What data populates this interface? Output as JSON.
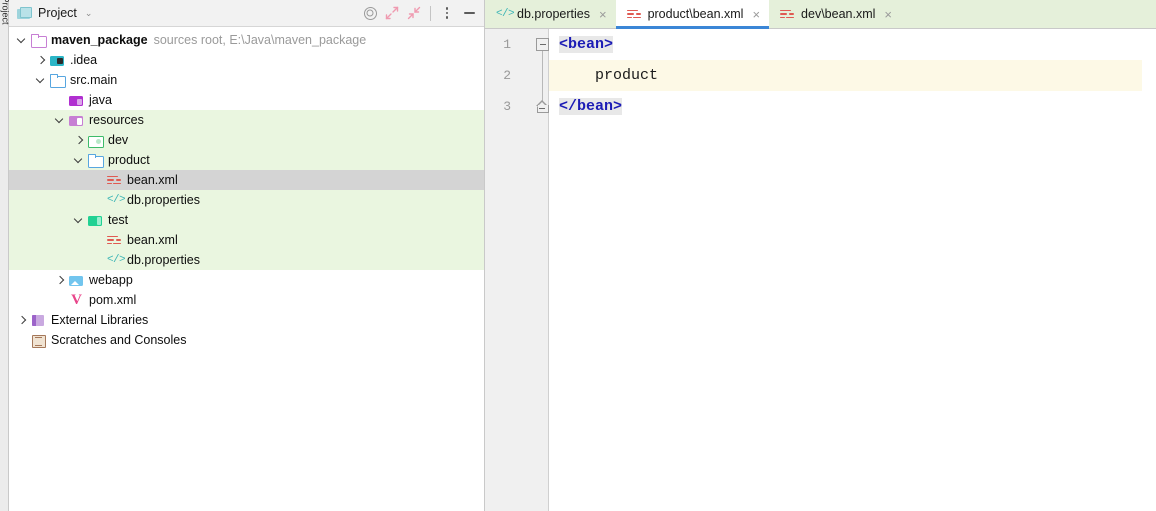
{
  "toolstrip": {
    "label": "Project",
    "icon": "project-window-icon"
  },
  "project_panel": {
    "header": {
      "icon": "project-folder-icon",
      "title": "Project",
      "chevron": "⌄",
      "buttons": [
        {
          "name": "select-opened-file-icon",
          "label": ""
        },
        {
          "name": "expand-all-icon",
          "label": ""
        },
        {
          "name": "collapse-all-icon",
          "label": ""
        },
        {
          "name": "more-options-icon",
          "label": ""
        },
        {
          "name": "hide-panel-icon",
          "label": ""
        }
      ]
    },
    "tree": [
      {
        "indent": 0,
        "arrow": "down",
        "icon": "folder-outline-purple",
        "label": "maven_package",
        "bold": true,
        "meta": "sources root,  E:\\Java\\maven_package",
        "band": false,
        "selected": false
      },
      {
        "indent": 1,
        "arrow": "right",
        "icon": "folder-idea",
        "label": ".idea",
        "bold": false,
        "meta": "",
        "band": false,
        "selected": false
      },
      {
        "indent": 1,
        "arrow": "down",
        "icon": "folder-blue",
        "label": "src.main",
        "bold": false,
        "meta": "",
        "band": false,
        "selected": false
      },
      {
        "indent": 2,
        "arrow": "none",
        "icon": "folder-java",
        "label": "java",
        "bold": false,
        "meta": "",
        "band": false,
        "selected": false
      },
      {
        "indent": 2,
        "arrow": "down",
        "icon": "folder-resources",
        "label": "resources",
        "bold": false,
        "meta": "",
        "band": true,
        "selected": false
      },
      {
        "indent": 3,
        "arrow": "right",
        "icon": "folder-green",
        "label": "dev",
        "bold": false,
        "meta": "",
        "band": true,
        "selected": false
      },
      {
        "indent": 3,
        "arrow": "down",
        "icon": "folder-blue",
        "label": "product",
        "bold": false,
        "meta": "",
        "band": true,
        "selected": false
      },
      {
        "indent": 4,
        "arrow": "none",
        "icon": "file-xml",
        "label": "bean.xml",
        "bold": false,
        "meta": "",
        "band": true,
        "selected": true
      },
      {
        "indent": 4,
        "arrow": "none",
        "icon": "file-properties",
        "label": "db.properties",
        "bold": false,
        "meta": "",
        "band": true,
        "selected": false
      },
      {
        "indent": 3,
        "arrow": "down",
        "icon": "folder-test",
        "label": "test",
        "bold": false,
        "meta": "",
        "band": true,
        "selected": false
      },
      {
        "indent": 4,
        "arrow": "none",
        "icon": "file-xml",
        "label": "bean.xml",
        "bold": false,
        "meta": "",
        "band": true,
        "selected": false
      },
      {
        "indent": 4,
        "arrow": "none",
        "icon": "file-properties",
        "label": "db.properties",
        "bold": false,
        "meta": "",
        "band": true,
        "selected": false
      },
      {
        "indent": 2,
        "arrow": "right",
        "icon": "folder-webapp",
        "label": "webapp",
        "bold": false,
        "meta": "",
        "band": false,
        "selected": false
      },
      {
        "indent": 2,
        "arrow": "none",
        "icon": "file-maven",
        "label": "pom.xml",
        "bold": false,
        "meta": "",
        "band": false,
        "selected": false
      },
      {
        "indent": 0,
        "arrow": "right",
        "icon": "library-icon",
        "label": "External Libraries",
        "bold": false,
        "meta": "",
        "band": false,
        "selected": false
      },
      {
        "indent": 0,
        "arrow": "none",
        "icon": "scratches-icon",
        "label": "Scratches and Consoles",
        "bold": false,
        "meta": "",
        "band": false,
        "selected": false
      }
    ]
  },
  "editor": {
    "tabs": [
      {
        "icon": "file-properties",
        "label": "db.properties",
        "close": "×",
        "active": false
      },
      {
        "icon": "file-xml",
        "label": "product\\bean.xml",
        "close": "×",
        "active": true
      },
      {
        "icon": "file-xml",
        "label": "dev\\bean.xml",
        "close": "×",
        "active": false
      }
    ],
    "lines": [
      {
        "number": "1",
        "indent": 0,
        "tag": "<bean>",
        "text": "",
        "caret": false,
        "fold": "top"
      },
      {
        "number": "2",
        "indent": 1,
        "tag": "",
        "text": "product",
        "caret": true,
        "fold": "none"
      },
      {
        "number": "3",
        "indent": 0,
        "tag": "</bean>",
        "text": "",
        "caret": false,
        "fold": "bottom"
      }
    ]
  },
  "colors": {
    "tab_active_underline": "#3b86d6",
    "tabbar_background": "#e5f0da",
    "tree_band": "#eaf6e0",
    "tree_selected": "#d4d4d4",
    "caret_line": "#fdf9e6",
    "xml_tag": "#1b1bb5",
    "tag_highlight": "#e8e8e8",
    "gutter": "#f0f0f0"
  }
}
